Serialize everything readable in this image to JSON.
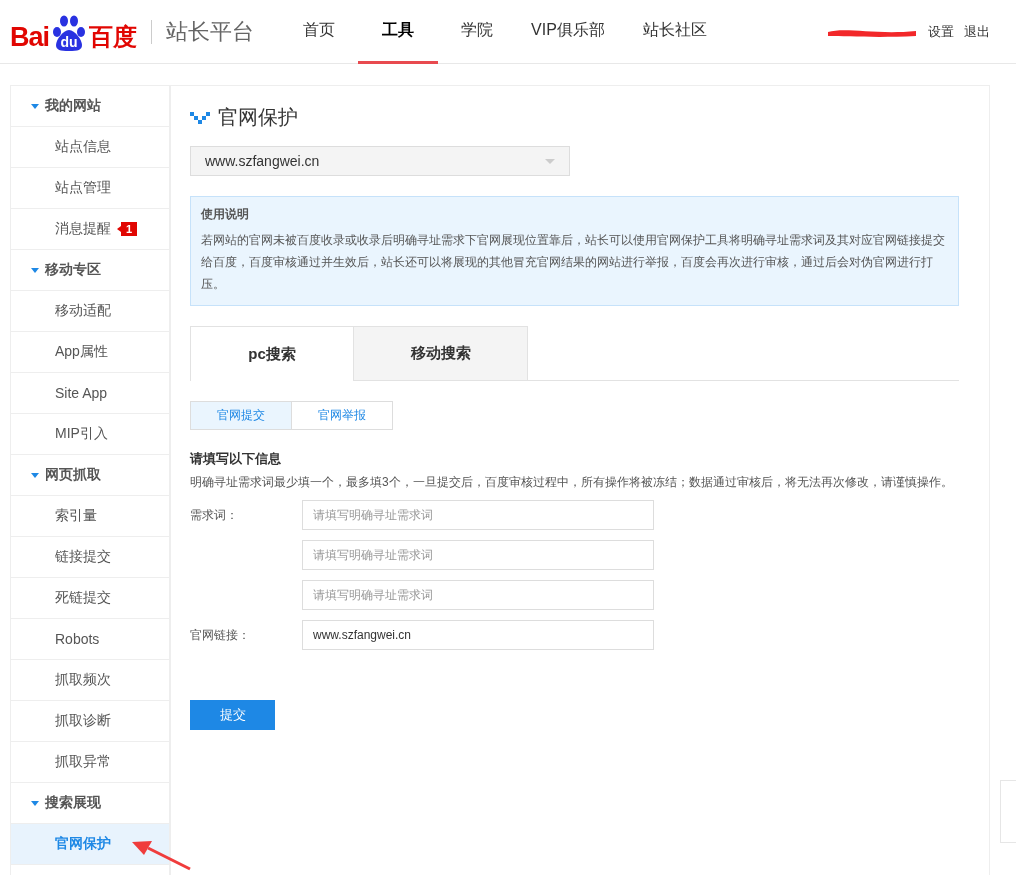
{
  "header": {
    "logo": {
      "latin": "Bai",
      "mark": "du",
      "cn": "百度"
    },
    "platform": "站长平台",
    "nav": [
      {
        "label": "首页",
        "selected": false
      },
      {
        "label": "工具",
        "selected": true
      },
      {
        "label": "学院",
        "selected": false
      },
      {
        "label": "VIP俱乐部",
        "selected": false
      },
      {
        "label": "站长社区",
        "selected": false
      }
    ],
    "user_links": [
      "设置",
      "退出"
    ]
  },
  "sidebar": [
    {
      "title": "我的网站",
      "expanded": true,
      "items": [
        {
          "label": "站点信息",
          "selected": false
        },
        {
          "label": "站点管理",
          "selected": false
        },
        {
          "label": "消息提醒",
          "selected": false,
          "badge": "1"
        }
      ]
    },
    {
      "title": "移动专区",
      "expanded": true,
      "items": [
        {
          "label": "移动适配",
          "selected": false
        },
        {
          "label": "App属性",
          "selected": false
        },
        {
          "label": "Site App",
          "selected": false
        },
        {
          "label": "MIP引入",
          "selected": false
        }
      ]
    },
    {
      "title": "网页抓取",
      "expanded": true,
      "items": [
        {
          "label": "索引量",
          "selected": false
        },
        {
          "label": "链接提交",
          "selected": false
        },
        {
          "label": "死链提交",
          "selected": false
        },
        {
          "label": "Robots",
          "selected": false
        },
        {
          "label": "抓取频次",
          "selected": false
        },
        {
          "label": "抓取诊断",
          "selected": false
        },
        {
          "label": "抓取异常",
          "selected": false
        }
      ]
    },
    {
      "title": "搜索展现",
      "expanded": true,
      "items": [
        {
          "label": "官网保护",
          "selected": true
        }
      ]
    }
  ],
  "main": {
    "title": "官网保护",
    "site_select": "www.szfangwei.cn",
    "notice": {
      "title": "使用说明",
      "text": "若网站的官网未被百度收录或收录后明确寻址需求下官网展现位置靠后，站长可以使用官网保护工具将明确寻址需求词及其对应官网链接提交给百度，百度审核通过并生效后，站长还可以将展现的其他冒充官网结果的网站进行举报，百度会再次进行审核，通过后会对伪官网进行打压。"
    },
    "tabs": [
      {
        "label": "pc搜索",
        "selected": true
      },
      {
        "label": "移动搜索",
        "selected": false
      }
    ],
    "subtabs": [
      {
        "label": "官网提交",
        "selected": true
      },
      {
        "label": "官网举报",
        "selected": false
      }
    ],
    "form": {
      "heading": "请填写以下信息",
      "description": "明确寻址需求词最少填一个，最多填3个，一旦提交后，百度审核过程中，所有操作将被冻结；数据通过审核后，将无法再次修改，请谨慎操作。",
      "fields": [
        {
          "label": "需求词：",
          "placeholder": "请填写明确寻址需求词"
        },
        {
          "placeholder": "请填写明确寻址需求词"
        },
        {
          "placeholder": "请填写明确寻址需求词"
        },
        {
          "label": "官网链接：",
          "value": "www.szfangwei.cn"
        }
      ],
      "submit": "提交"
    }
  }
}
